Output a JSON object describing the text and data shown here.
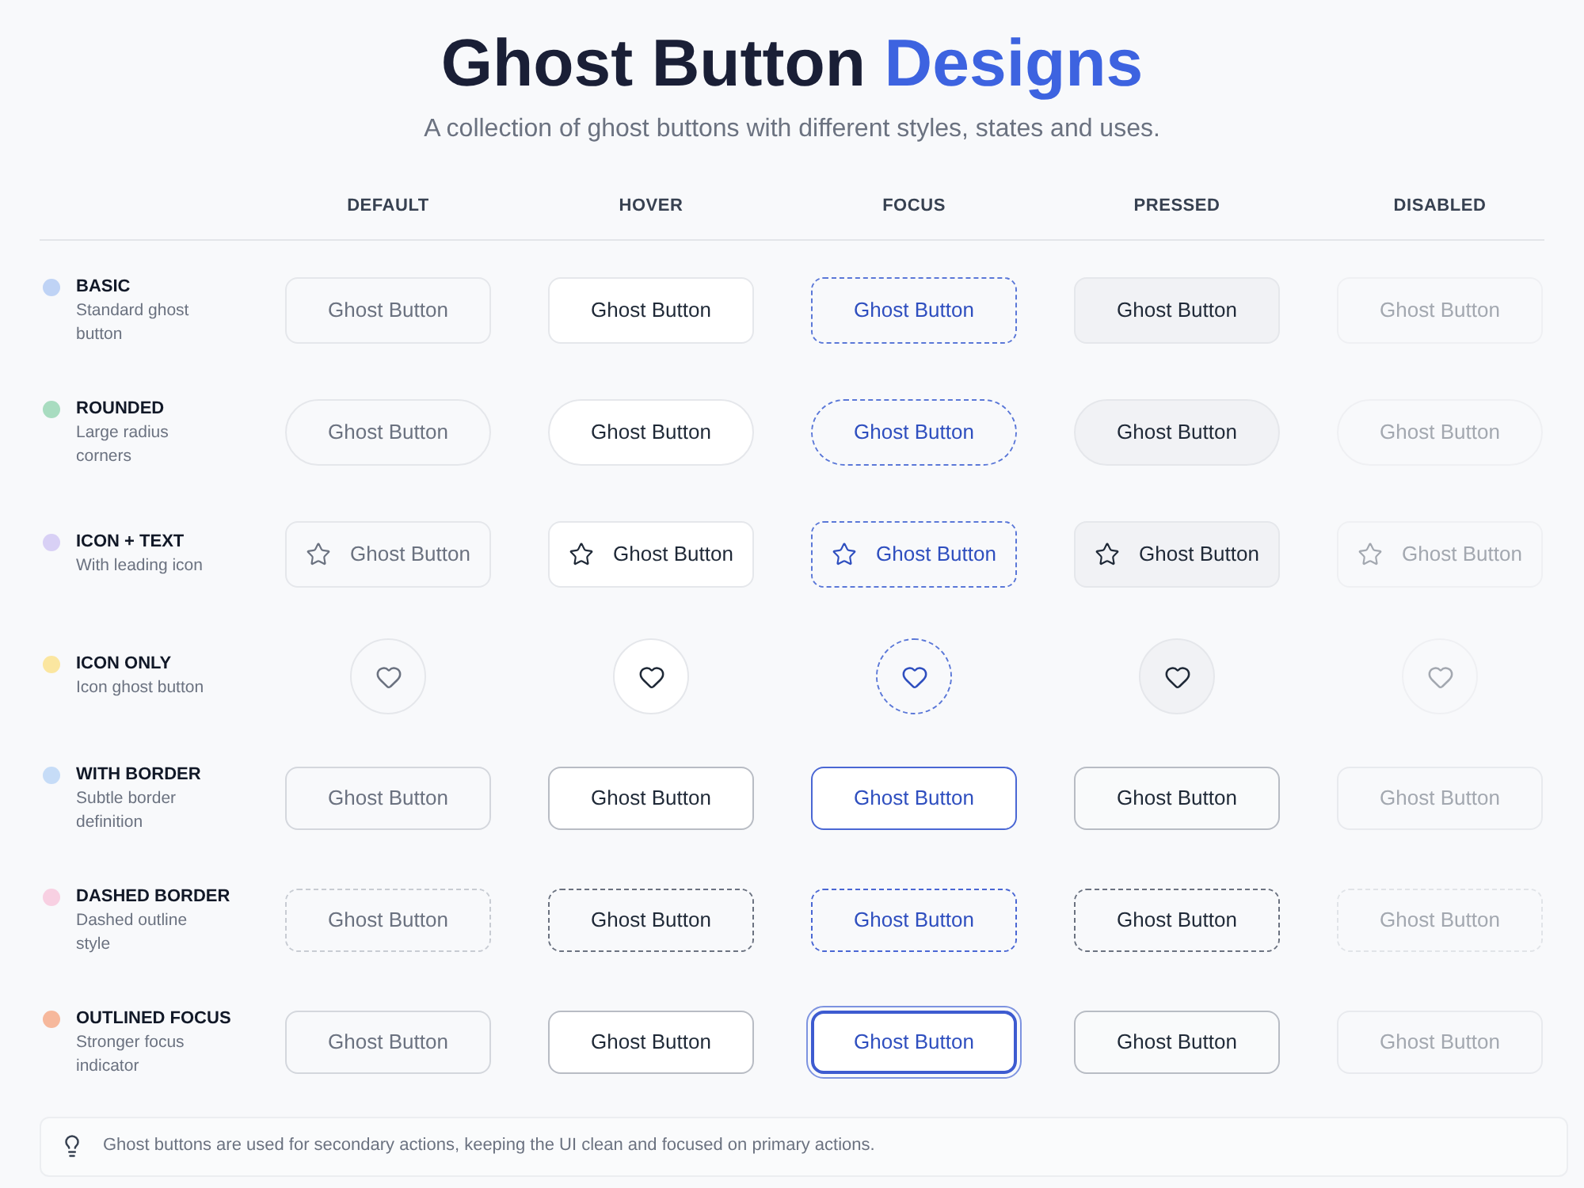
{
  "title": {
    "text": "Ghost Button",
    "accent": "Designs"
  },
  "subtitle": "A collection of ghost buttons with different styles, states and uses.",
  "columns": [
    {
      "label": "DEFAULT",
      "kind": "default"
    },
    {
      "label": "HOVER",
      "kind": "hover"
    },
    {
      "label": "FOCUS",
      "kind": "focus"
    },
    {
      "label": "PRESSED",
      "kind": "pressed"
    },
    {
      "label": "DISABLED",
      "kind": "disabled"
    }
  ],
  "rows": [
    {
      "kind": "basic",
      "title": "BASIC",
      "description": "Standard ghost button",
      "color": "#bfd3f5",
      "cells": [
        "Ghost Button",
        "Ghost Button",
        "Ghost Button",
        "Ghost Button",
        "Ghost Button"
      ]
    },
    {
      "kind": "rounded",
      "title": "ROUNDED",
      "description": "Large radius corners",
      "color": "#a8dcc0",
      "cells": [
        "Ghost Button",
        "Ghost Button",
        "Ghost Button",
        "Ghost Button",
        "Ghost Button"
      ]
    },
    {
      "kind": "icon_text",
      "title": "ICON + TEXT",
      "description": "With leading icon",
      "color": "#d8d0f5",
      "cells": [
        "Ghost Button",
        "Ghost Button",
        "Ghost Button",
        "Ghost Button",
        "Ghost Button"
      ]
    },
    {
      "kind": "icon_only",
      "title": "ICON ONLY",
      "description": "Icon ghost button",
      "color": "#fbe6a0"
    },
    {
      "kind": "bordered",
      "title": "WITH BORDER",
      "description": "Subtle border definition",
      "color": "#c6dcf7",
      "cells": [
        "Ghost Button",
        "Ghost Button",
        "Ghost Button",
        "Ghost Button",
        "Ghost Button"
      ]
    },
    {
      "kind": "dashed",
      "title": "DASHED BORDER",
      "description": "Dashed outline style",
      "color": "#f8d0e2",
      "cells": [
        "Ghost Button",
        "Ghost Button",
        "Ghost Button",
        "Ghost Button",
        "Ghost Button"
      ]
    },
    {
      "kind": "outlined_focus",
      "title": "OUTLINED FOCUS",
      "description": "Stronger focus indicator",
      "color": "#f6b89c",
      "cells": [
        "Ghost Button",
        "Ghost Button",
        "Ghost Button",
        "Ghost Button",
        "Ghost Button"
      ]
    }
  ],
  "footer": "Ghost buttons are used for secondary actions, keeping the UI clean and focused on primary actions."
}
